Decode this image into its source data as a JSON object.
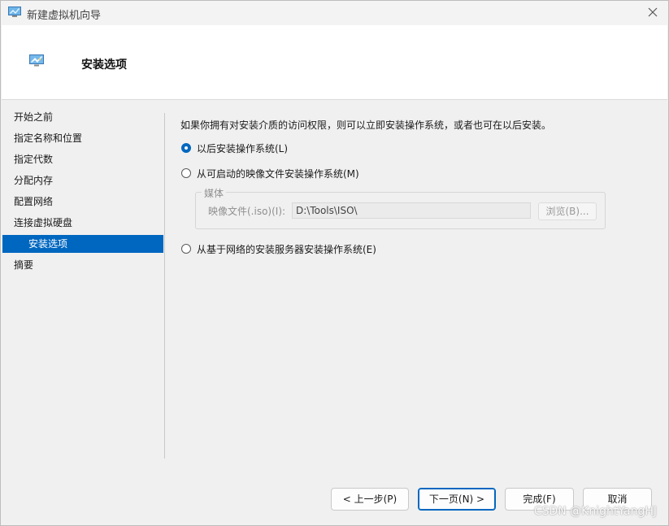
{
  "window": {
    "title": "新建虚拟机向导",
    "close_icon": "close-icon"
  },
  "header": {
    "title": "安装选项",
    "icon": "vm-monitor-icon"
  },
  "nav": {
    "items": [
      {
        "label": "开始之前"
      },
      {
        "label": "指定名称和位置"
      },
      {
        "label": "指定代数"
      },
      {
        "label": "分配内存"
      },
      {
        "label": "配置网络"
      },
      {
        "label": "连接虚拟硬盘"
      },
      {
        "label": "安装选项"
      },
      {
        "label": "摘要"
      }
    ],
    "active_index": 6
  },
  "content": {
    "intro": "如果你拥有对安装介质的访问权限，则可以立即安装操作系统，或者也可在以后安装。",
    "options": [
      {
        "label": "以后安装操作系统(L)",
        "checked": true
      },
      {
        "label": "从可启动的映像文件安装操作系统(M)",
        "checked": false
      },
      {
        "label": "从基于网络的安装服务器安装操作系统(E)",
        "checked": false
      }
    ],
    "media": {
      "legend": "媒体",
      "image_label": "映像文件(.iso)(I):",
      "image_path": "D:\\Tools\\ISO\\",
      "browse_label": "浏览(B)..."
    }
  },
  "footer": {
    "prev_label": "< 上一步(P)",
    "next_label": "下一页(N) >",
    "finish_label": "完成(F)",
    "cancel_label": "取消"
  },
  "watermark": "CSDN @KnightYangHJ",
  "colors": {
    "accent": "#0067c0",
    "header_bg": "#ffffff",
    "window_bg": "#f0f0f0"
  }
}
